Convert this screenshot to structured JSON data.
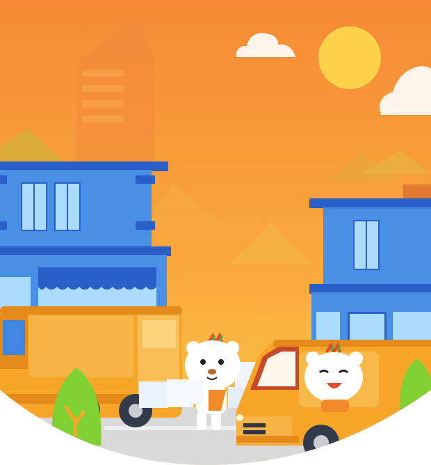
{
  "scene": {
    "description_label": "",
    "colors": {
      "sky_top": "#f7933a",
      "sky_bottom": "#fbc23f",
      "building_blue": "#3f86e0",
      "building_dark_blue": "#2f6fd0",
      "window": "#a9dcff",
      "van_orange": "#f7a62a",
      "van_dark": "#e58a18",
      "sun": "#fdd24b",
      "cloud": "#fff6ee",
      "road": "#d9d9d9",
      "tree_green": "#7fd033",
      "white": "#ffffff"
    },
    "icons": [
      "sun-icon",
      "cloud-icon",
      "building-icon",
      "van-icon",
      "cat-mascot-icon",
      "tree-icon"
    ]
  }
}
